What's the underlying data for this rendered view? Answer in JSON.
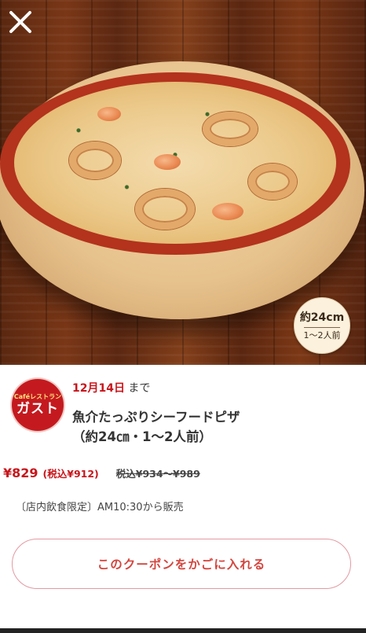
{
  "close": {
    "icon": "close-icon"
  },
  "hero": {
    "size_badge": {
      "size": "約24cm",
      "servings": "1〜2人前"
    }
  },
  "brand": {
    "logo_small": "Caféレストラン",
    "logo_big": "ガスト"
  },
  "offer": {
    "date": "12月14日",
    "until_suffix": "まで",
    "title_line1": "魚介たっぷりシーフードピザ",
    "title_line2": "（約24㎝・1〜2人前）",
    "price": "¥829",
    "price_tax": "(税込¥912)",
    "price_original": "税込¥934〜¥989",
    "note": "〔店内飲食限定〕AM10:30から販売"
  },
  "cta": {
    "label": "このクーポンをかごに入れる"
  },
  "colors": {
    "accent": "#c7161c",
    "cta_border": "#e39aa2",
    "cta_text": "#d4463f"
  }
}
